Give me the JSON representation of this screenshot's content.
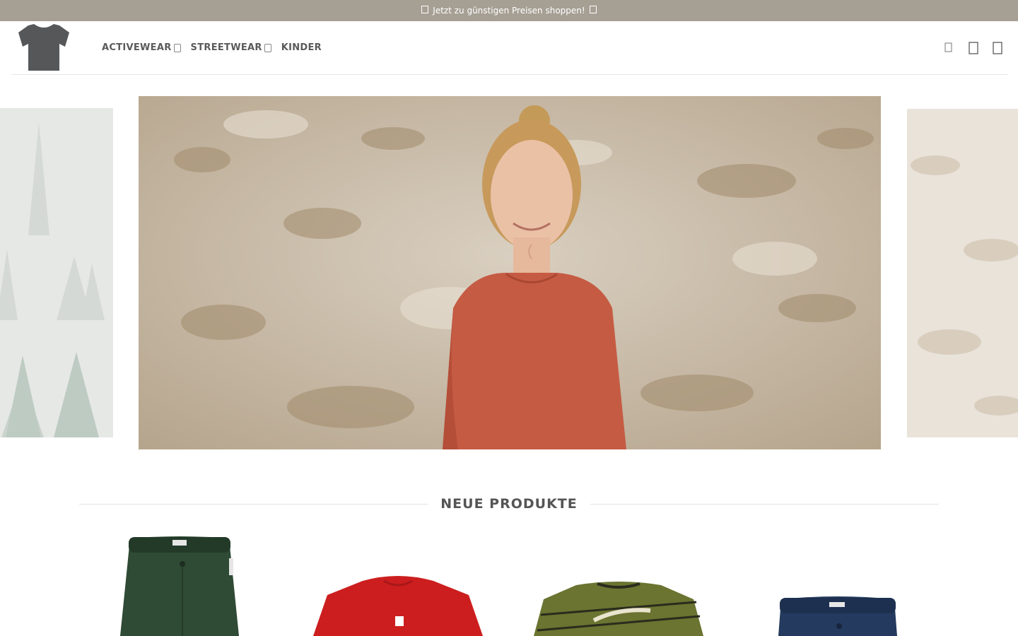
{
  "announcement": {
    "icon_left": "gift-icon",
    "text": "Jetzt zu günstigen Preisen shoppen!",
    "icon_right": "gift-icon"
  },
  "header": {
    "logo": "tshirt-logo",
    "nav": [
      {
        "label": "ACTIVEWEAR",
        "has_dropdown": true
      },
      {
        "label": "STREETWEAR",
        "has_dropdown": true
      },
      {
        "label": "KINDER",
        "has_dropdown": false
      }
    ],
    "icons": [
      "search-icon",
      "account-icon",
      "cart-icon"
    ]
  },
  "hero": {
    "slides": [
      "foggy-forest-slide",
      "woman-orange-longsleeve-slide",
      "stone-wall-slide"
    ]
  },
  "section": {
    "title": "NEUE PRODUKTE"
  },
  "products": [
    {
      "image": "green-shorts",
      "color": "#2f4a35"
    },
    {
      "image": "red-tshirt",
      "color": "#cc1e1e"
    },
    {
      "image": "olive-maloja-tshirt",
      "color": "#6b7430"
    },
    {
      "image": "navy-shorts",
      "color": "#243a5e"
    }
  ],
  "colors": {
    "announcement_bg": "#a69f94",
    "text": "#555555"
  }
}
